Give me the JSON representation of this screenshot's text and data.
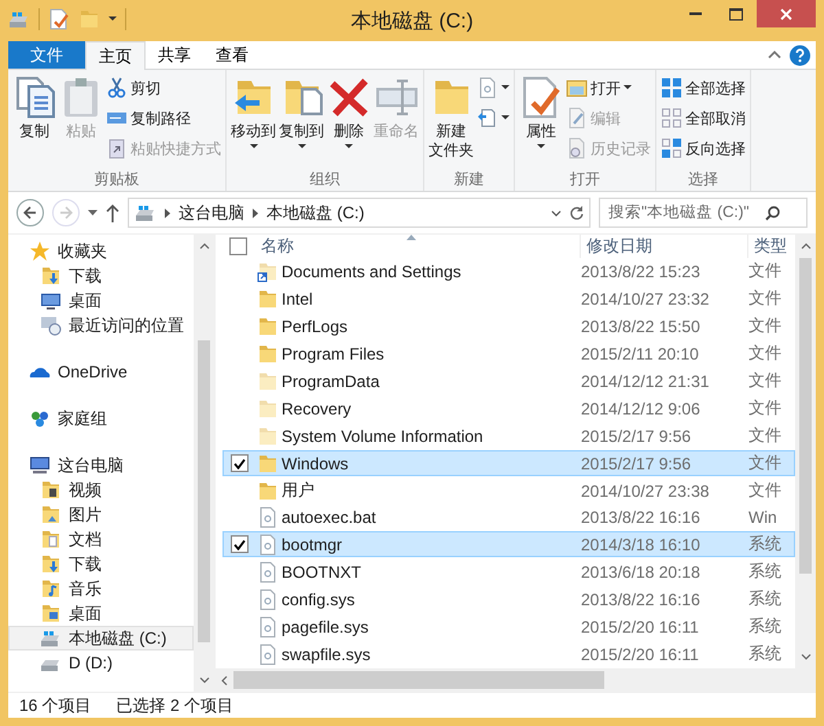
{
  "window": {
    "title": "本地磁盘 (C:)"
  },
  "ribbon_tabs": [
    {
      "label": "文件",
      "kind": "file",
      "selected": false
    },
    {
      "label": "主页",
      "kind": "tab",
      "selected": true
    },
    {
      "label": "共享",
      "kind": "tab",
      "selected": false
    },
    {
      "label": "查看",
      "kind": "tab",
      "selected": false
    }
  ],
  "ribbon_groups": [
    {
      "label": "剪贴板",
      "buttons": [
        {
          "label": "复制",
          "kind": "copy",
          "large": true,
          "disabled": false,
          "dropdown": false
        },
        {
          "label": "粘贴",
          "kind": "paste",
          "large": true,
          "disabled": true,
          "dropdown": false
        },
        {
          "label": "剪切",
          "kind": "cut",
          "large": false,
          "disabled": false,
          "dropdown": false
        },
        {
          "label": "复制路径",
          "kind": "copypath",
          "large": false,
          "disabled": false,
          "dropdown": false
        },
        {
          "label": "粘贴快捷方式",
          "kind": "pasteshortcut",
          "large": false,
          "disabled": true,
          "dropdown": false
        }
      ]
    },
    {
      "label": "组织",
      "buttons": [
        {
          "label": "移动到",
          "kind": "moveto",
          "large": true,
          "disabled": false,
          "dropdown": true
        },
        {
          "label": "复制到",
          "kind": "copyto",
          "large": true,
          "disabled": false,
          "dropdown": true
        },
        {
          "label": "删除",
          "kind": "delete",
          "large": true,
          "disabled": false,
          "dropdown": true
        },
        {
          "label": "重命名",
          "kind": "rename",
          "large": true,
          "disabled": true,
          "dropdown": false
        }
      ]
    },
    {
      "label": "新建",
      "buttons": [
        {
          "lines": [
            "新建",
            "文件夹"
          ],
          "kind": "newfolder",
          "large": true,
          "disabled": false,
          "dropdown": false
        },
        {
          "kind": "newitem",
          "large": false,
          "disabled": false,
          "dropdown": true
        },
        {
          "kind": "easyaccess",
          "large": false,
          "disabled": false,
          "dropdown": true
        }
      ]
    },
    {
      "label": "打开",
      "buttons": [
        {
          "label": "属性",
          "kind": "properties",
          "large": true,
          "disabled": false,
          "dropdown": true
        },
        {
          "label": "打开",
          "kind": "open",
          "large": false,
          "disabled": false,
          "dropdown": true
        },
        {
          "label": "编辑",
          "kind": "edit",
          "large": false,
          "disabled": true,
          "dropdown": false
        },
        {
          "label": "历史记录",
          "kind": "history",
          "large": false,
          "disabled": true,
          "dropdown": false
        }
      ]
    },
    {
      "label": "选择",
      "buttons": [
        {
          "label": "全部选择",
          "kind": "selectall",
          "large": false,
          "disabled": false,
          "dropdown": false
        },
        {
          "label": "全部取消",
          "kind": "selectnone",
          "large": false,
          "disabled": false,
          "dropdown": false
        },
        {
          "label": "反向选择",
          "kind": "invert",
          "large": false,
          "disabled": false,
          "dropdown": false
        }
      ]
    }
  ],
  "address": {
    "back_enabled": true,
    "forward_enabled": false,
    "path": [
      "这台电脑",
      "本地磁盘 (C:)"
    ],
    "search_placeholder": "搜索\"本地磁盘 (C:)\""
  },
  "nav": [
    {
      "label": "收藏夹",
      "kind": "star",
      "selected": false,
      "children": [
        {
          "label": "下载",
          "kind": "download",
          "selected": false
        },
        {
          "label": "桌面",
          "kind": "desktop",
          "selected": false
        },
        {
          "label": "最近访问的位置",
          "kind": "recent",
          "selected": false
        }
      ]
    },
    {
      "label": "OneDrive",
      "kind": "cloud",
      "selected": false
    },
    {
      "label": "家庭组",
      "kind": "homegroup",
      "selected": false
    },
    {
      "label": "这台电脑",
      "kind": "computer",
      "selected": false,
      "children": [
        {
          "label": "视频",
          "kind": "video",
          "selected": false
        },
        {
          "label": "图片",
          "kind": "pictures",
          "selected": false
        },
        {
          "label": "文档",
          "kind": "docs",
          "selected": false
        },
        {
          "label": "下载",
          "kind": "download",
          "selected": false
        },
        {
          "label": "音乐",
          "kind": "music",
          "selected": false
        },
        {
          "label": "桌面",
          "kind": "desktopfolder",
          "selected": false
        },
        {
          "label": "本地磁盘 (C:)",
          "kind": "drive",
          "selected": true
        },
        {
          "label": "D (D:)",
          "kind": "disk",
          "selected": false
        }
      ]
    }
  ],
  "columns": [
    {
      "label": "名称",
      "sorted": true
    },
    {
      "label": "修改日期",
      "sorted": false
    },
    {
      "label": "类型",
      "sorted": false
    }
  ],
  "select_all_checked": false,
  "files": [
    {
      "name": "Documents and Settings",
      "date": "2013/8/22 15:23",
      "type": "文件",
      "kind": "link",
      "selected": false
    },
    {
      "name": "Intel",
      "date": "2014/10/27 23:32",
      "type": "文件",
      "kind": "folder",
      "selected": false
    },
    {
      "name": "PerfLogs",
      "date": "2013/8/22 15:50",
      "type": "文件",
      "kind": "folder",
      "selected": false
    },
    {
      "name": "Program Files",
      "date": "2015/2/11 20:10",
      "type": "文件",
      "kind": "folder",
      "selected": false
    },
    {
      "name": "ProgramData",
      "date": "2014/12/12 21:31",
      "type": "文件",
      "kind": "hiddenfolder",
      "selected": false
    },
    {
      "name": "Recovery",
      "date": "2014/12/12 9:06",
      "type": "文件",
      "kind": "hiddenfolder",
      "selected": false
    },
    {
      "name": "System Volume Information",
      "date": "2015/2/17 9:56",
      "type": "文件",
      "kind": "hiddenfolder",
      "selected": false
    },
    {
      "name": "Windows",
      "date": "2015/2/17 9:56",
      "type": "文件",
      "kind": "folder",
      "selected": true
    },
    {
      "name": "用户",
      "date": "2014/10/27 23:38",
      "type": "文件",
      "kind": "folder",
      "selected": false
    },
    {
      "name": "autoexec.bat",
      "date": "2013/8/22 16:16",
      "type": "Win",
      "kind": "batfile",
      "selected": false
    },
    {
      "name": "bootmgr",
      "date": "2014/3/18 16:10",
      "type": "系统",
      "kind": "sysfile",
      "selected": true
    },
    {
      "name": "BOOTNXT",
      "date": "2013/6/18 20:18",
      "type": "系统",
      "kind": "sysfile",
      "selected": false
    },
    {
      "name": "config.sys",
      "date": "2013/8/22 16:16",
      "type": "系统",
      "kind": "sysfile",
      "selected": false
    },
    {
      "name": "pagefile.sys",
      "date": "2015/2/20 16:11",
      "type": "系统",
      "kind": "sysfile",
      "selected": false
    },
    {
      "name": "swapfile.sys",
      "date": "2015/2/20 16:11",
      "type": "系统",
      "kind": "sysfile",
      "selected": false
    }
  ],
  "status_bar": {
    "count": "16 个项目",
    "selection": "已选择 2 个项目"
  }
}
